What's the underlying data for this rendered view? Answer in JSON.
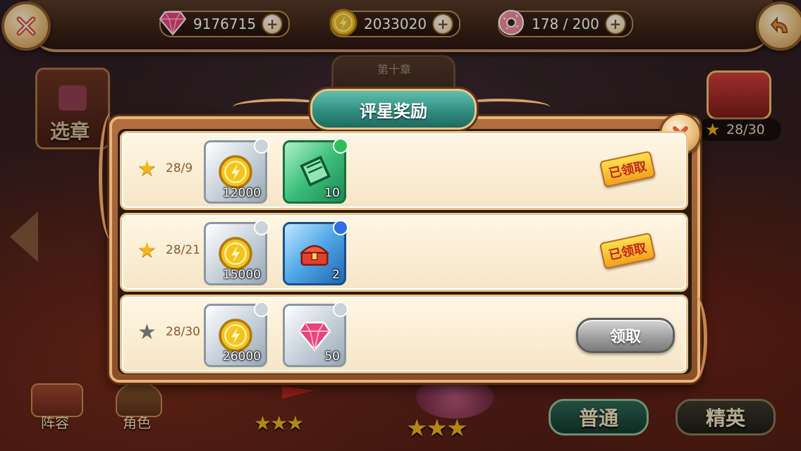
{
  "header": {
    "gems": "9176715",
    "coins": "2033020",
    "stamina": "178 / 200"
  },
  "background": {
    "chapter_select_label": "选章",
    "lineup_label": "阵容",
    "character_label": "角色",
    "chapter_plate_line1": "第十章",
    "chapter_plate_line2": "",
    "star_progress": "28/30",
    "normal_label": "普通",
    "elite_label": "精英"
  },
  "modal": {
    "title": "评星奖励",
    "rows": [
      {
        "requirement": "28/9",
        "star_filled": true,
        "items": [
          {
            "icon": "gold-coin-icon",
            "frame": "silver",
            "count": "12000"
          },
          {
            "icon": "green-ticket-icon",
            "frame": "green",
            "count": "10"
          }
        ],
        "status_label": "已领取",
        "claimed": true
      },
      {
        "requirement": "28/21",
        "star_filled": true,
        "items": [
          {
            "icon": "gold-coin-icon",
            "frame": "silver",
            "count": "15000"
          },
          {
            "icon": "red-chest-icon",
            "frame": "blue",
            "count": "2"
          }
        ],
        "status_label": "已领取",
        "claimed": true
      },
      {
        "requirement": "28/30",
        "star_filled": false,
        "items": [
          {
            "icon": "gold-coin-icon",
            "frame": "silver",
            "count": "26000"
          },
          {
            "icon": "pink-gem-icon",
            "frame": "silver",
            "count": "50"
          }
        ],
        "status_label": "领取",
        "claimed": false
      }
    ]
  },
  "colors": {
    "star_gold": "#f2b51a",
    "star_grey": "#6c6c6c",
    "accent_teal": "#2d8a7c"
  }
}
